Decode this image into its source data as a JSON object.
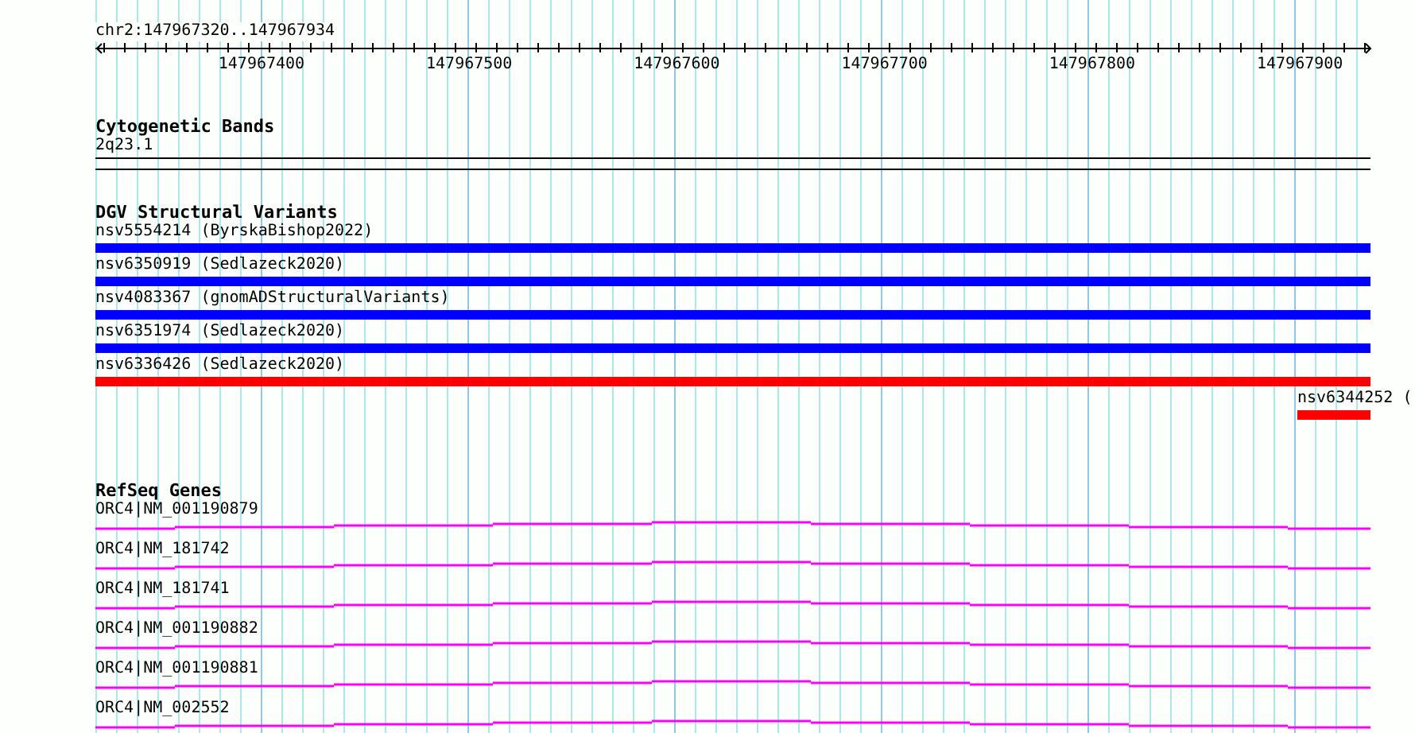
{
  "location": "chr2:147967320..147967934",
  "ruler": {
    "tick_labels": [
      "147967400",
      "147967500",
      "147967600",
      "147967700",
      "147967800",
      "147967900"
    ]
  },
  "cytobands": {
    "title": "Cytogenetic Bands",
    "bands": [
      {
        "label": "2q23.1"
      }
    ]
  },
  "variants": {
    "title": "DGV Structural Variants",
    "items": [
      {
        "label": "nsv5554214 (ByrskaBishop2022)",
        "color": "#0000ff",
        "kind": "span"
      },
      {
        "label": "nsv6350919 (Sedlazeck2020)",
        "color": "#0000ff",
        "kind": "span"
      },
      {
        "label": "nsv4083367 (gnomADStructuralVariants)",
        "color": "#0000ff",
        "kind": "span"
      },
      {
        "label": "nsv6351974 (Sedlazeck2020)",
        "color": "#0000ff",
        "kind": "span"
      },
      {
        "label": "nsv6336426 (Sedlazeck2020)",
        "color": "#ff0000",
        "kind": "span"
      },
      {
        "label": "nsv6344252 (",
        "color": "#ff0000",
        "kind": "edge"
      }
    ]
  },
  "genes": {
    "title": "RefSeq Genes",
    "transcripts": [
      {
        "label": "ORC4|NM_001190879"
      },
      {
        "label": "ORC4|NM_181742"
      },
      {
        "label": "ORC4|NM_181741"
      },
      {
        "label": "ORC4|NM_001190882"
      },
      {
        "label": "ORC4|NM_001190881"
      },
      {
        "label": "ORC4|NM_002552"
      }
    ]
  }
}
